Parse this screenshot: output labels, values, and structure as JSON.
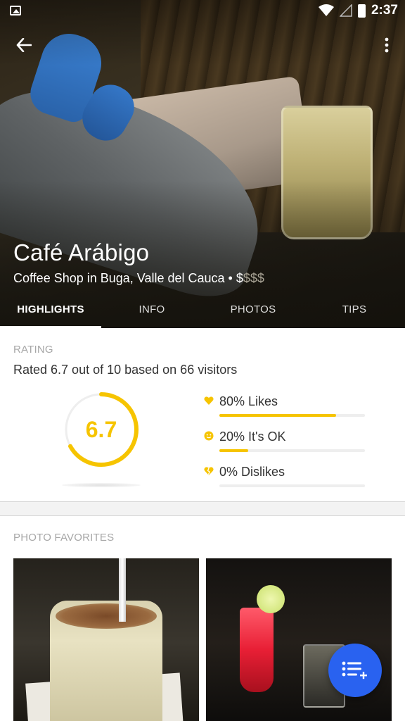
{
  "status_bar": {
    "time": "2:37",
    "icons": [
      "gallery-icon",
      "wifi-icon",
      "signal-icon",
      "battery-icon"
    ]
  },
  "header": {
    "back_icon": "arrow-left-icon",
    "more_icon": "more-vert-icon",
    "venue_name": "Café Arábigo",
    "subtitle": "Coffee Shop in Buga, Valle del Cauca • ",
    "price_active": "$",
    "price_inactive": "$$$"
  },
  "tabs": [
    {
      "label": "HIGHLIGHTS",
      "active": true
    },
    {
      "label": "INFO",
      "active": false
    },
    {
      "label": "PHOTOS",
      "active": false
    },
    {
      "label": "TIPS",
      "active": false
    }
  ],
  "rating": {
    "section_label": "RATING",
    "summary": "Rated 6.7 out of 10 based on 66 visitors",
    "score": "6.7",
    "score_fraction": 0.67,
    "accent_color": "#f6c400",
    "stats": [
      {
        "label": "80% Likes",
        "percent": 80,
        "icon": "heart-icon"
      },
      {
        "label": "20% It's OK",
        "percent": 20,
        "icon": "smiley-icon"
      },
      {
        "label": "0% Dislikes",
        "percent": 0,
        "icon": "broken-heart-icon"
      }
    ]
  },
  "photo_favorites": {
    "section_label": "PHOTO FAVORITES"
  },
  "fab": {
    "icon": "add-to-list-icon",
    "color": "#2962f0"
  }
}
